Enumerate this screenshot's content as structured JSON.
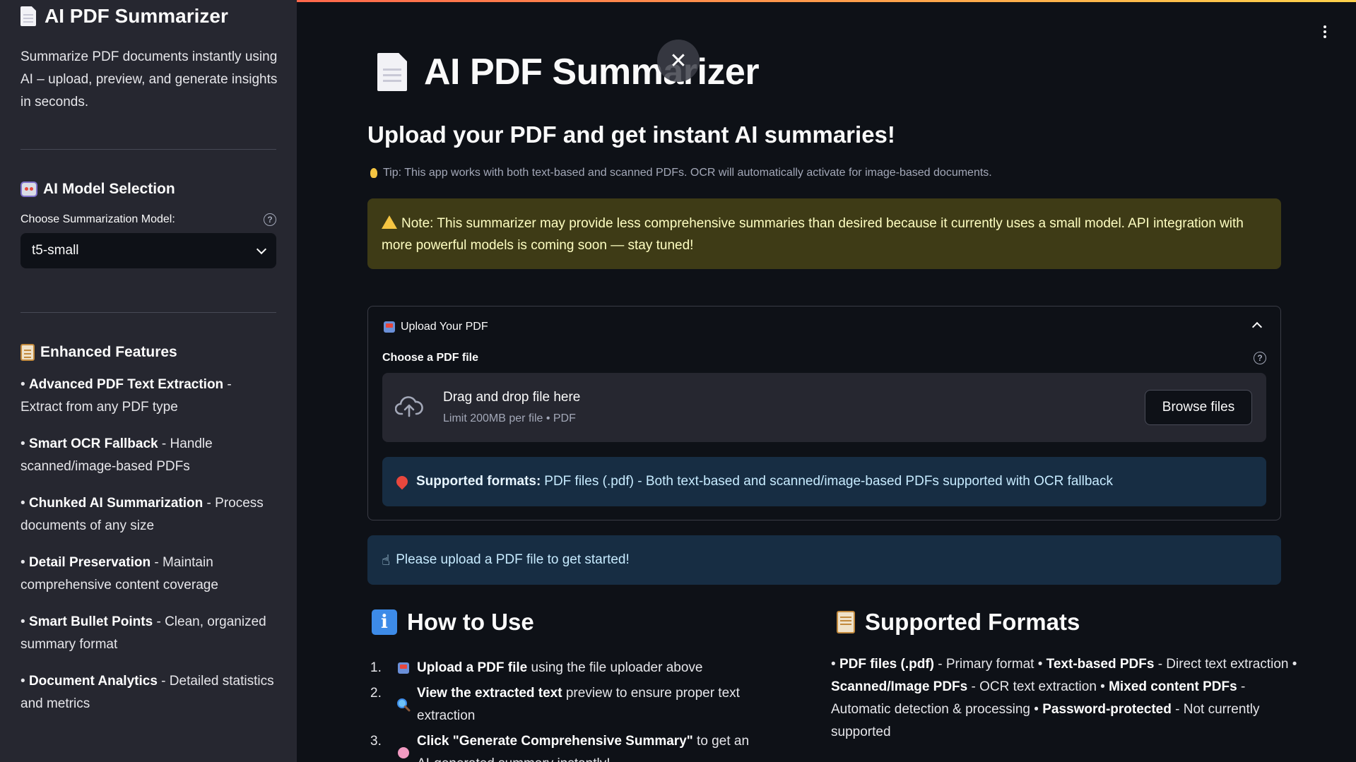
{
  "sidebar": {
    "title": "AI PDF Summarizer",
    "description": "Summarize PDF documents instantly using AI – upload, preview, and generate insights in seconds.",
    "model_section": {
      "heading": "AI Model Selection",
      "label": "Choose Summarization Model:",
      "selected": "t5-small"
    },
    "features_section": {
      "heading": "Enhanced Features",
      "items": [
        {
          "bold": "Advanced PDF Text Extraction",
          "text": " - Extract from any PDF type"
        },
        {
          "bold": "Smart OCR Fallback",
          "text": " - Handle scanned/image-based PDFs"
        },
        {
          "bold": "Chunked AI Summarization",
          "text": " - Process documents of any size"
        },
        {
          "bold": "Detail Preservation",
          "text": " - Maintain comprehensive content coverage"
        },
        {
          "bold": "Smart Bullet Points",
          "text": " - Clean, organized summary format"
        },
        {
          "bold": "Document Analytics",
          "text": " - Detailed statistics and metrics"
        }
      ]
    }
  },
  "main": {
    "title": "AI PDF Summarizer",
    "subtitle": "Upload your PDF and get instant AI summaries!",
    "tip": "Tip: This app works with both text-based and scanned PDFs. OCR will automatically activate for image-based documents.",
    "warning": "Note: This summarizer may provide less comprehensive summaries than desired because it currently uses a small model. API integration with more powerful models is coming soon — stay tuned!",
    "upload": {
      "header": "Upload Your PDF",
      "label": "Choose a PDF file",
      "drop_text": "Drag and drop file here",
      "limit_text": "Limit 200MB per file • PDF",
      "browse_label": "Browse files",
      "formats_bold": "Supported formats:",
      "formats_text": "PDF files (.pdf) - Both text-based and scanned/image-based PDFs supported with OCR fallback"
    },
    "get_started": "Please upload a PDF file to get started!",
    "how_to": {
      "heading": "How to Use",
      "steps": [
        {
          "num": "1.",
          "bold": "Upload a PDF file",
          "text": " using the file uploader above"
        },
        {
          "num": "2.",
          "bold": "View the extracted text",
          "text": " preview to ensure proper text extraction"
        },
        {
          "num": "3.",
          "bold": "Click \"Generate Comprehensive Summary\"",
          "text": " to get an AI-generated summary instantly!"
        }
      ]
    },
    "supported": {
      "heading": "Supported Formats",
      "segments": [
        {
          "bold": "PDF files (.pdf)",
          "text": " - Primary format • "
        },
        {
          "bold": "Text-based PDFs",
          "text": " - Direct text extraction • "
        },
        {
          "bold": "Scanned/Image PDFs",
          "text": " - OCR text extraction • "
        },
        {
          "bold": "Mixed content PDFs",
          "text": " - Automatic detection & processing • "
        },
        {
          "bold": "Password-protected",
          "text": " - Not currently supported"
        }
      ]
    }
  },
  "colors": {
    "background": "#0e1117",
    "sidebar": "#262730",
    "warning_bg": "#3e3b16",
    "info_bg": "#172d43"
  },
  "icons": [
    "page-icon",
    "robot-icon",
    "clipboard-icon",
    "help-icon",
    "chevron-down-icon",
    "close-icon",
    "bulb-icon",
    "warning-icon",
    "inbox-icon",
    "chevron-up-icon",
    "cloud-upload-icon",
    "pin-icon",
    "pointing-hand-icon",
    "info-icon",
    "menu-icon"
  ]
}
